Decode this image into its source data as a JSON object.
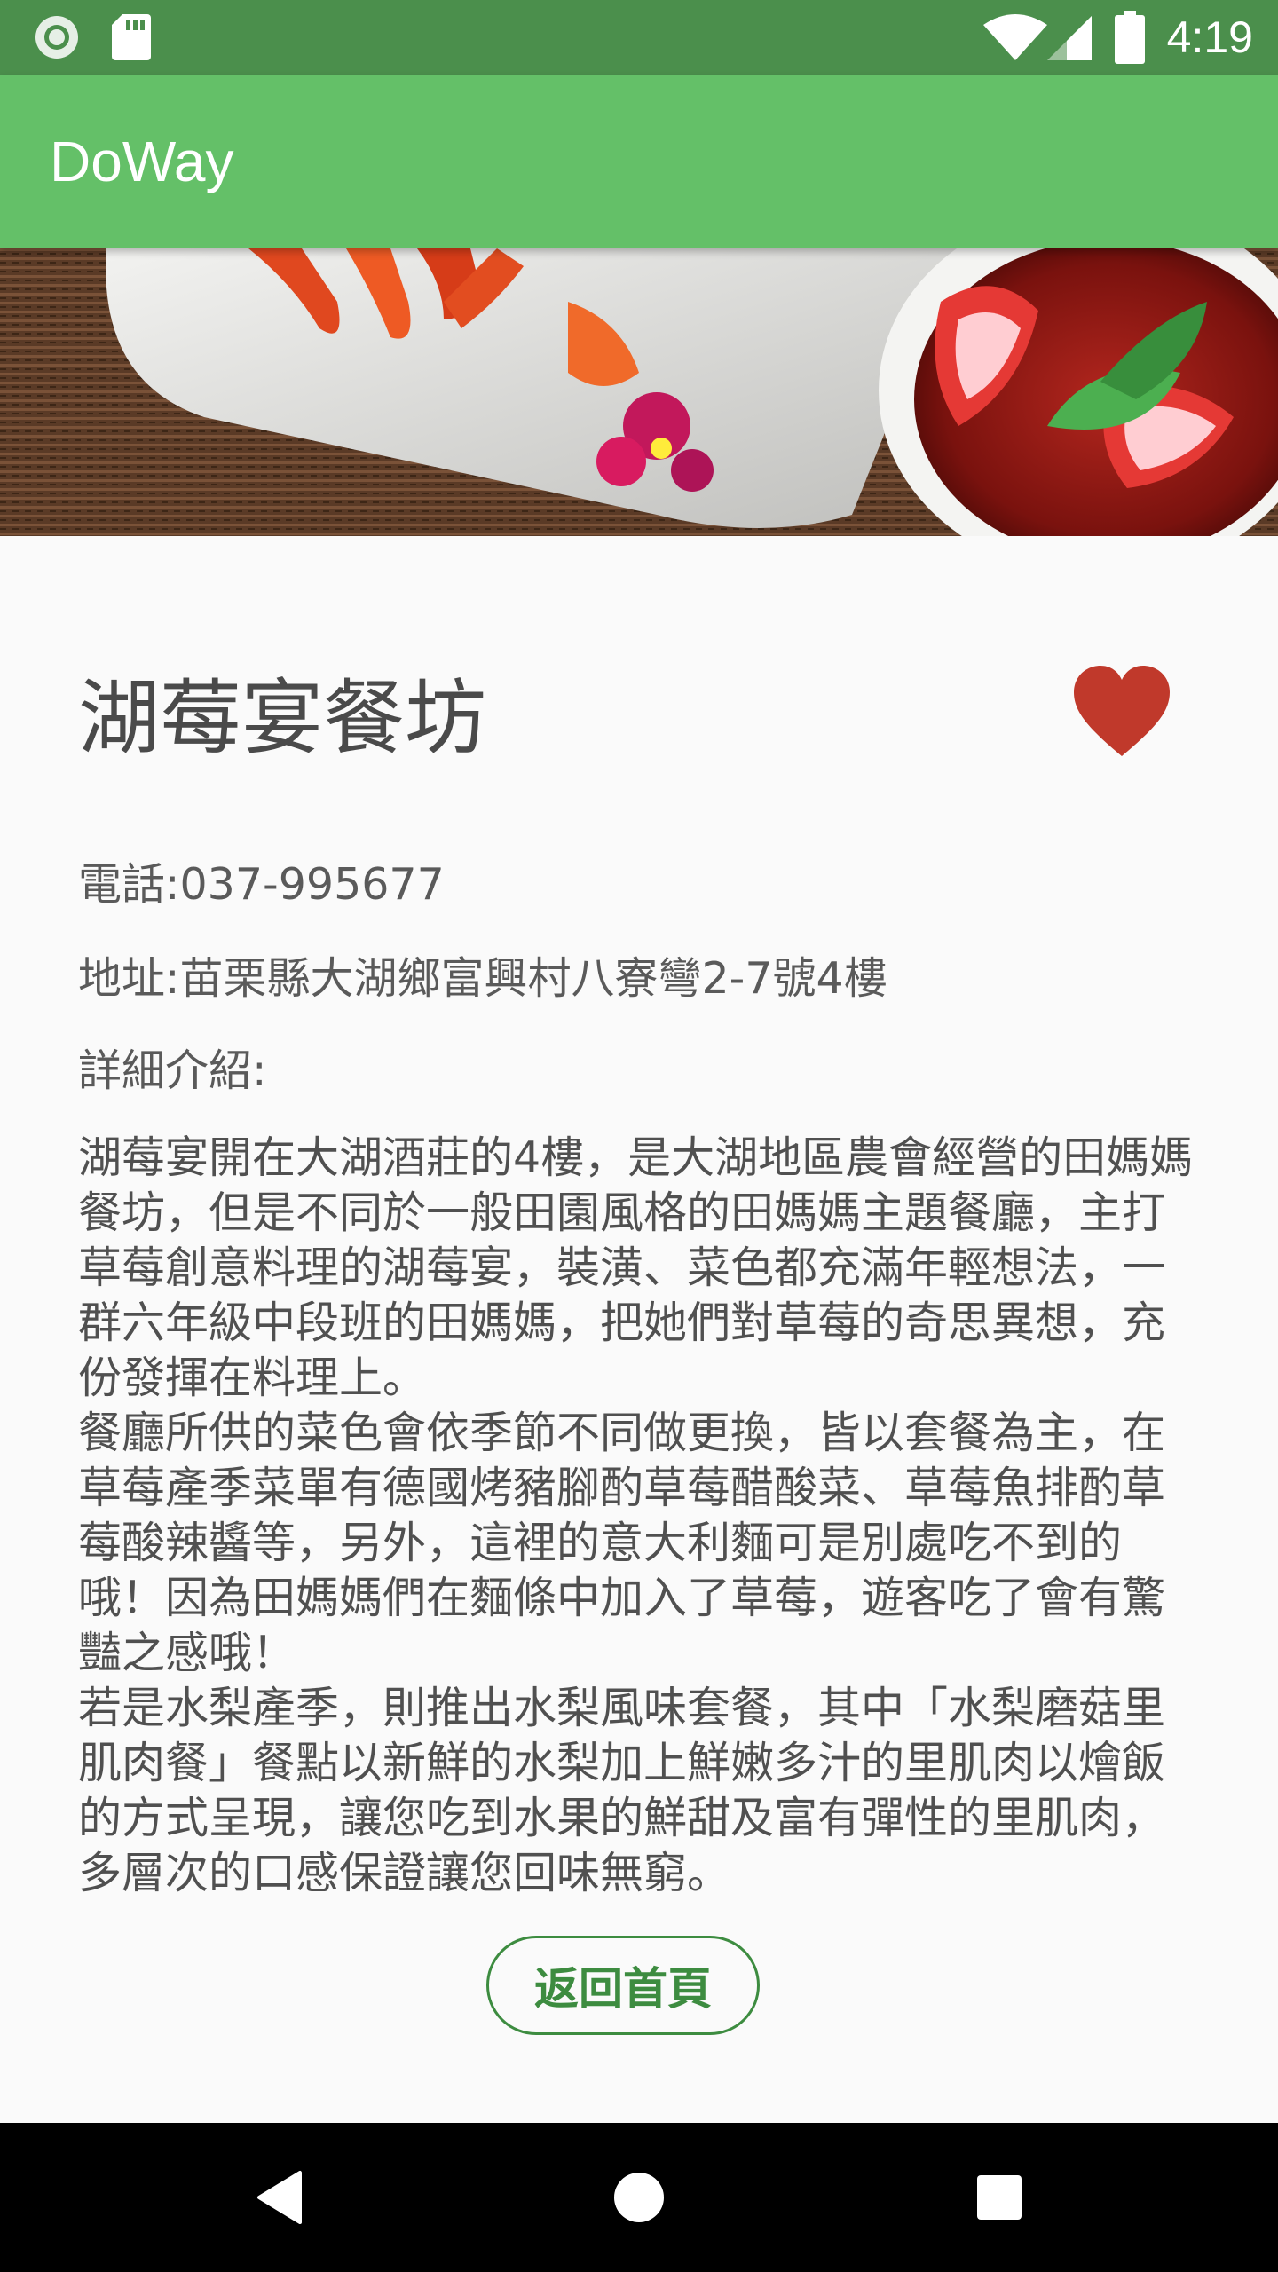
{
  "status_bar": {
    "time": "4:19",
    "icons": [
      "circle-indicator-icon",
      "sd-card-icon",
      "wifi-icon",
      "signal-icon",
      "battery-icon"
    ]
  },
  "app_bar": {
    "title": "DoWay",
    "color": "#64c068"
  },
  "banner": {
    "icon": "food-photo"
  },
  "restaurant": {
    "name": "湖莓宴餐坊",
    "favorite_icon": "heart-icon",
    "phone": "電話:037-995677",
    "address": "地址:苗栗縣大湖鄉富興村八寮彎2-7號4樓",
    "detail_label": "詳細介紹:",
    "description": "湖莓宴開在大湖酒莊的4樓，是大湖地區農會經營的田媽媽餐坊，但是不同於一般田園風格的田媽媽主題餐廳，主打草莓創意料理的湖莓宴，裝潢、菜色都充滿年輕想法，一群六年級中段班的田媽媽，把她們對草莓的奇思異想，充份發揮在料理上。\n餐廳所供的菜色會依季節不同做更換，皆以套餐為主，在草莓產季菜單有德國烤豬腳酌草莓醋酸菜、草莓魚排酌草莓酸辣醬等，另外，這裡的意大利麵可是別處吃不到的哦！因為田媽媽們在麵條中加入了草莓，遊客吃了會有驚豔之感哦！\n若是水梨產季，則推出水梨風味套餐，其中「水梨磨菇里肌肉餐」餐點以新鮮的水梨加上鮮嫩多汁的里肌肉以燴飯的方式呈現，讓您吃到水果的鮮甜及富有彈性的里肌肉，多層次的口感保證讓您回味無窮。"
  },
  "actions": {
    "home_button": "返回首頁"
  },
  "nav_bar": {
    "icons": [
      "back-icon",
      "home-icon",
      "recents-icon"
    ]
  },
  "colors": {
    "status_bar": "#4b8f4c",
    "accent": "#3d8c40",
    "heart": "#c0392b"
  }
}
